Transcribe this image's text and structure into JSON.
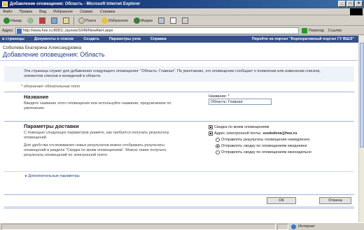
{
  "window": {
    "title": "Добавление оповещения: Область - Microsoft Internet Explorer",
    "controls": [
      "_",
      "□",
      "×"
    ]
  },
  "menu": [
    "Файл",
    "Правка",
    "Вид",
    "Избранное",
    "Сервис",
    "Справка"
  ],
  "toolbar": {
    "back": "Назад",
    "search": "Поиск",
    "favorites": "Избранное",
    "media": "Медиа"
  },
  "address": {
    "label": "Адрес",
    "url": "http://www.hse.ru:8081/_layouts/1049/NewAlert.aspx",
    "go": "Переход",
    "links": "Ссылки"
  },
  "portal_nav": {
    "items": [
      "в страницы",
      "Документы и списки",
      "Создать",
      "Параметры узла",
      "Справка"
    ],
    "portal_link": "Перейти на портал \"Корпоративный портал ГУ ВШЭ\""
  },
  "user_name": "Соболева Екатерина Александровна",
  "page_title": "Добавление оповещения: Область",
  "intro_text": "Эта страница служит для добавления следующего оповещения: \"Область: Главная\". По умолчанию, это оповещение сообщает о появлении или изменении списков, элементов списков и вхождений в области.",
  "required_note": "* обозначает обязательные поля",
  "name_section": {
    "heading": "Название",
    "description": "Введите название этого оповещения или используйте название, предлагаемое по умолчанию.",
    "field_label": "Название: *",
    "field_value": "Область: Главная"
  },
  "delivery_section": {
    "heading": "Параметры доставки",
    "description_1": "С помощью следующих параметров укажите, как требуется получать результаты оповещений.",
    "description_2": "Для удобства отслеживания новых результатов можно отображать результаты оповещений в разделе \"Сводка по моим оповещениям\". Можно также получать результаты оповещений по электронной почте.",
    "summary_label": "Сводка по моим оповещениям",
    "email_label": "Адрес электронной почты:",
    "email_value": "esokoleva@hse.ru",
    "opt_immediate": "Отправлять результаты оповещения немедленно",
    "opt_daily": "Отправлять сводку по оповещениям ежедневно",
    "opt_weekly": "Отправлять сводку по оповещениям еженедельно"
  },
  "extra_params": "Дополнительные параметры",
  "buttons": {
    "ok": "ОК",
    "cancel": "Отмена"
  },
  "status": {
    "zone": "Интернет"
  }
}
